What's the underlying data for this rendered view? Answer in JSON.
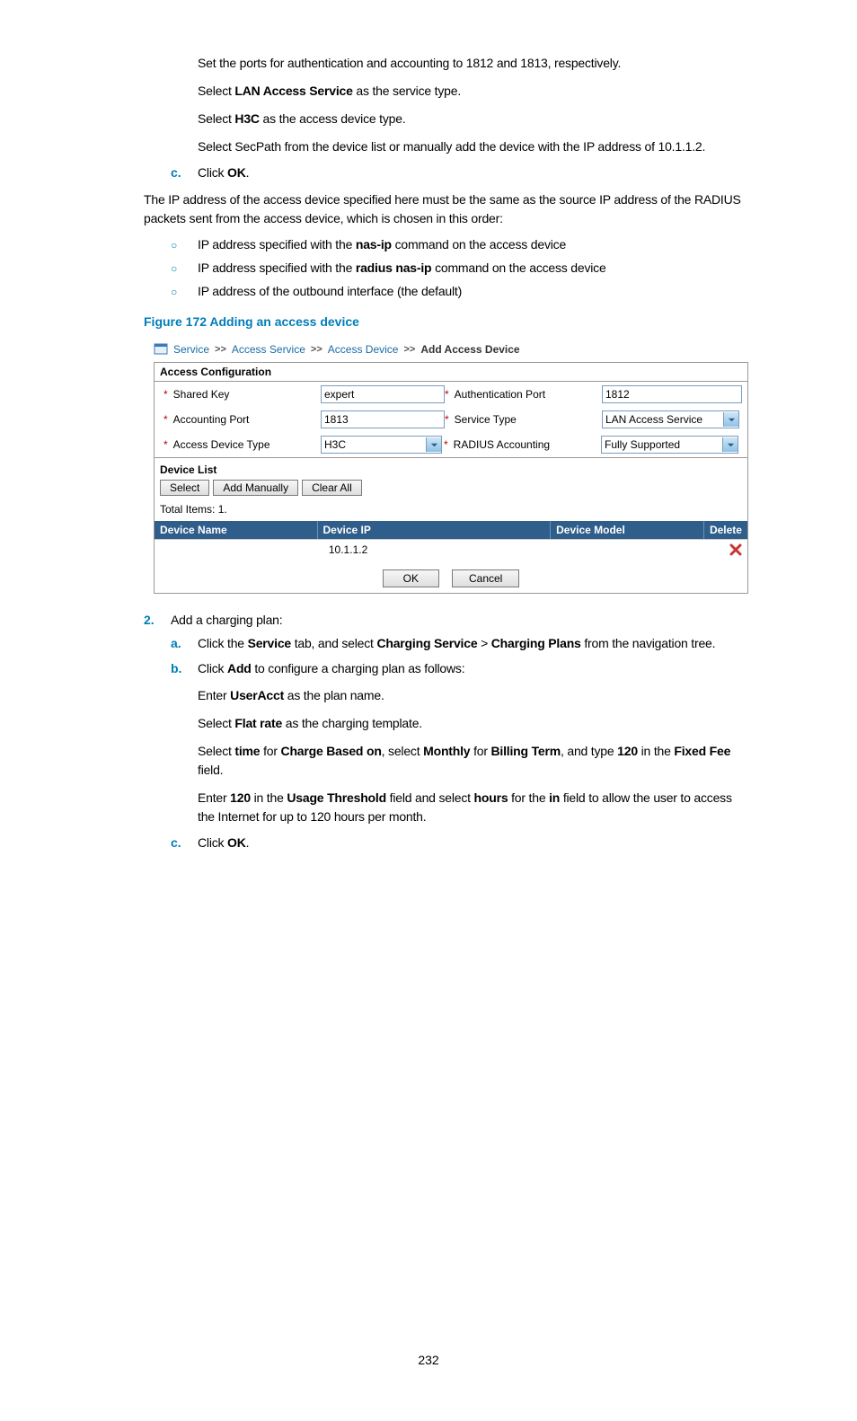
{
  "text": {
    "p1": "Set the ports for authentication and accounting to 1812 and 1813, respectively.",
    "p2a": "Select ",
    "p2b": "LAN Access Service",
    "p2c": " as the service type.",
    "p3a": "Select ",
    "p3b": "H3C",
    "p3c": " as the access device type.",
    "p4": "Select SecPath from the device list or manually add the device with the IP address of 10.1.1.2.",
    "cMarker": "c.",
    "c1a": "Click ",
    "c1b": "OK",
    "c1c": ".",
    "p5": "The IP address of the access device specified here must be the same as the source IP address of the RADIUS packets sent from the access device, which is chosen in this order:",
    "oMarker": "○",
    "o1a": "IP address specified with the ",
    "o1b": "nas-ip",
    "o1c": " command on the access device",
    "o2a": "IP address specified with the ",
    "o2b": "radius nas-ip",
    "o2c": " command on the access device",
    "o3": "IP address of the outbound interface (the default)",
    "figCaption": "Figure 172 Adding an access device",
    "numMarker": "2.",
    "num1": "Add a charging plan:",
    "aMarker": "a.",
    "a1a": "Click the ",
    "a1b": "Service",
    "a1c": " tab, and select ",
    "a1d": "Charging Service",
    "a1e": " > ",
    "a1f": "Charging Plans",
    "a1g": " from the navigation tree.",
    "bMarker": "b.",
    "b1a": "Click ",
    "b1b": "Add",
    "b1c": " to configure a charging plan as follows:",
    "b2a": "Enter ",
    "b2b": "UserAcct",
    "b2c": " as the plan name.",
    "b3a": "Select ",
    "b3b": "Flat rate",
    "b3c": " as the charging template.",
    "b4a": "Select ",
    "b4b": "time",
    "b4c": " for ",
    "b4d": "Charge Based on",
    "b4e": ", select ",
    "b4f": "Monthly",
    "b4g": " for ",
    "b4h": "Billing Term",
    "b4i": ", and type ",
    "b4j": "120",
    "b4k": " in the ",
    "b4l": "Fixed Fee",
    "b4m": " field.",
    "b5a": "Enter ",
    "b5b": "120",
    "b5c": " in the ",
    "b5d": "Usage Threshold",
    "b5e": " field and select ",
    "b5f": "hours",
    "b5g": " for the ",
    "b5h": "in",
    "b5i": " field to allow the user to access the Internet for up to 120 hours per month.",
    "c2a": "Click ",
    "c2b": "OK",
    "c2c": "."
  },
  "figure": {
    "breadcrumb": {
      "l1": "Service",
      "l2": "Access Service",
      "l3": "Access Device",
      "current": "Add Access Device",
      "sep": ">>"
    },
    "panelTitle": "Access Configuration",
    "labels": {
      "sharedKey": "Shared Key",
      "acctPort": "Accounting Port",
      "devType": "Access Device Type",
      "authPort": "Authentication Port",
      "svcType": "Service Type",
      "radiusAcct": "RADIUS Accounting"
    },
    "values": {
      "sharedKey": "expert",
      "acctPort": "1813",
      "devType": "H3C",
      "authPort": "1812",
      "svcType": "LAN Access Service",
      "radiusAcct": "Fully Supported"
    },
    "devList": {
      "title": "Device List",
      "btnSelect": "Select",
      "btnAddM": "Add Manually",
      "btnClear": "Clear All",
      "total": "Total Items: 1.",
      "thName": "Device Name",
      "thIP": "Device IP",
      "thModel": "Device Model",
      "thDel": "Delete",
      "rowIP": "10.1.1.2"
    },
    "buttons": {
      "ok": "OK",
      "cancel": "Cancel"
    }
  },
  "pageNumber": "232"
}
